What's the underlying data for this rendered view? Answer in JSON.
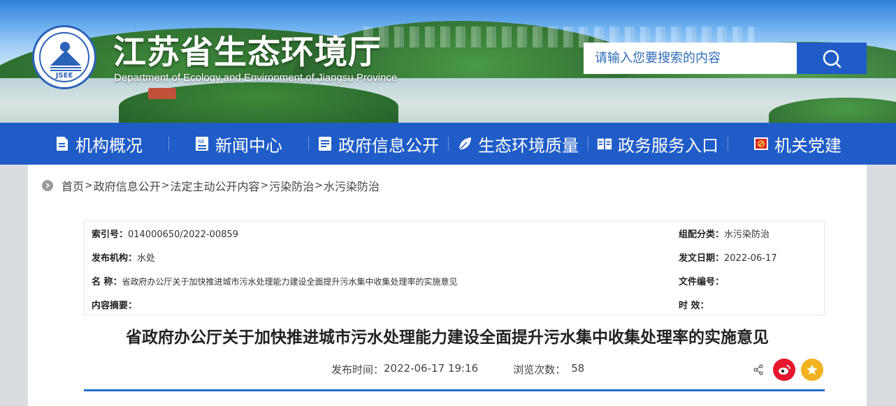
{
  "header": {
    "site_title": "江苏省生态环境厅",
    "site_subtitle": "Department of Ecology and Environment of Jiangsu Province",
    "logo_text": "JSEE"
  },
  "search": {
    "placeholder": "请输入您要搜索的内容",
    "button_icon": "search-icon"
  },
  "nav": {
    "items": [
      {
        "label": "机构概况",
        "icon": "document-icon"
      },
      {
        "label": "新闻中心",
        "icon": "newspaper-icon"
      },
      {
        "label": "政府信息公开",
        "icon": "file-icon"
      },
      {
        "label": "生态环境质量",
        "icon": "leaf-icon"
      },
      {
        "label": "政务服务入口",
        "icon": "book-icon"
      },
      {
        "label": "机关党建",
        "icon": "party-flag-icon"
      }
    ]
  },
  "breadcrumb": {
    "items": [
      "首页",
      "政府信息公开",
      "法定主动公开内容",
      "污染防治",
      "水污染防治"
    ],
    "separator": ">"
  },
  "meta": {
    "index_no_label": "索引号：",
    "index_no": "014000650/2022-00859",
    "category_label": "组配分类：",
    "category": "水污染防治",
    "publisher_label": "发布机构：",
    "publisher": "水处",
    "issue_date_label": "发文日期：",
    "issue_date": "2022-06-17",
    "name_label": "名 称：",
    "name": "省政府办公厅关于加快推进城市污水处理能力建设全面提升污水集中收集处理率的实施意见",
    "doc_no_label": "文件编号：",
    "doc_no": "",
    "summary_label": "内容摘要：",
    "summary": "",
    "validity_label": "时 效：",
    "validity": ""
  },
  "article": {
    "title": "省政府办公厅关于加快推进城市污水处理能力建设全面提升污水集中收集处理率的实施意见",
    "publish_time_label": "发布时间：",
    "publish_time": "2022-06-17 19:16",
    "views_label": "浏览次数：",
    "views": "58"
  },
  "colors": {
    "nav_bg": "#1f5cc8",
    "accent": "#1f6fc8",
    "weibo": "#e6162d",
    "favorite": "#f2b221"
  }
}
